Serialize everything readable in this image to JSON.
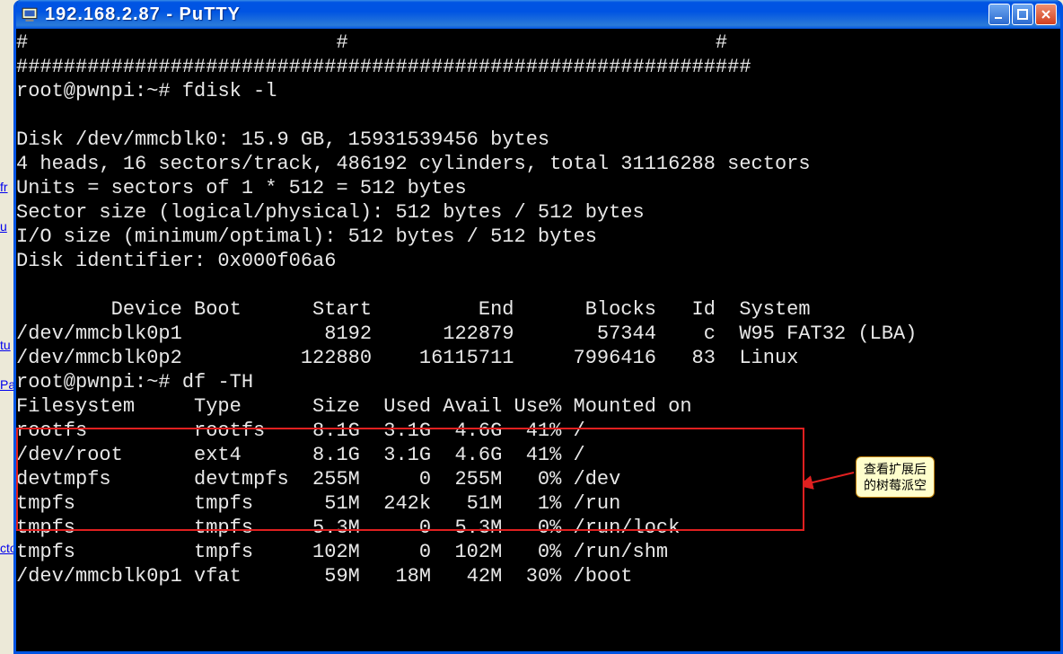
{
  "window": {
    "title": "192.168.2.87 - PuTTY"
  },
  "terminal": {
    "line1": "#                          #                               #",
    "line2": "##############################################################",
    "prompt1_user": "root@pwnpi",
    "prompt1_rest": ":~# fdisk -l",
    "blank": "",
    "fdisk": {
      "l1": "Disk /dev/mmcblk0: 15.9 GB, 15931539456 bytes",
      "l2": "4 heads, 16 sectors/track, 486192 cylinders, total 31116288 sectors",
      "l3": "Units = sectors of 1 * 512 = 512 bytes",
      "l4": "Sector size (logical/physical): 512 bytes / 512 bytes",
      "l5": "I/O size (minimum/optimal): 512 bytes / 512 bytes",
      "l6": "Disk identifier: 0x000f06a6"
    },
    "part_header": "        Device Boot      Start         End      Blocks   Id  System",
    "part_rows": [
      "/dev/mmcblk0p1            8192      122879       57344    c  W95 FAT32 (LBA)",
      "/dev/mmcblk0p2          122880    16115711     7996416   83  Linux"
    ],
    "prompt2_user": "root@pwnpi",
    "prompt2_rest": ":~# df -TH",
    "df_header": "Filesystem     Type      Size  Used Avail Use% Mounted on",
    "df_rows": [
      "rootfs         rootfs    8.1G  3.1G  4.6G  41% /",
      "/dev/root      ext4      8.1G  3.1G  4.6G  41% /",
      "devtmpfs       devtmpfs  255M     0  255M   0% /dev",
      "tmpfs          tmpfs      51M  242k   51M   1% /run",
      "tmpfs          tmpfs     5.3M     0  5.3M   0% /run/lock",
      "tmpfs          tmpfs     102M     0  102M   0% /run/shm",
      "/dev/mmcblk0p1 vfat       59M   18M   42M  30% /boot"
    ]
  },
  "callout": {
    "line1": "查看扩展后",
    "line2": "的树莓派空"
  },
  "bg": {
    "l1": "fr",
    "l2": "u",
    "l3": "",
    "l4": "tu",
    "l5": "Pa",
    "l6": "cto"
  }
}
